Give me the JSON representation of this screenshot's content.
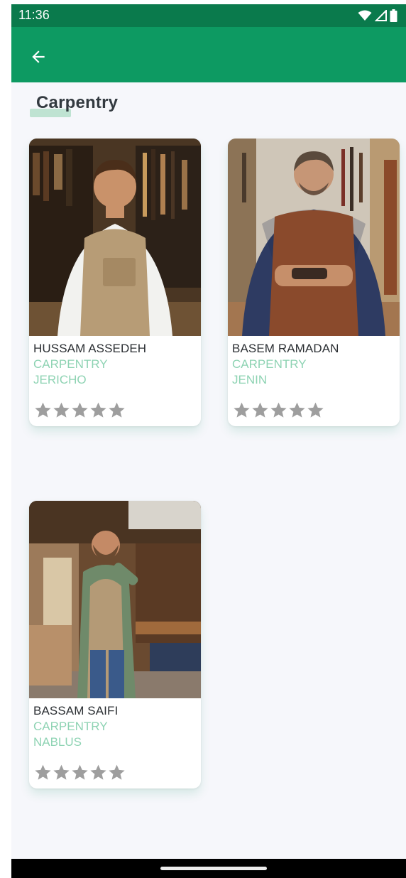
{
  "status_bar": {
    "time": "11:36",
    "icons": [
      "wifi-icon",
      "cell-signal-icon",
      "battery-icon"
    ]
  },
  "app_bar": {
    "back_icon": "arrow-back-icon",
    "background_color": "#0d9a62",
    "status_bar_color": "#0a7a4c"
  },
  "page": {
    "title": "Carpentry"
  },
  "workers": [
    {
      "name": "HUSSAM ASSEDEH",
      "category": "CARPENTRY",
      "city": "JERICHO",
      "rating": 0,
      "max_rating": 5
    },
    {
      "name": "BASEM RAMADAN",
      "category": "CARPENTRY",
      "city": "JENIN",
      "rating": 0,
      "max_rating": 5
    },
    {
      "name": "BASSAM SAIFI",
      "category": "CARPENTRY",
      "city": "NABLUS",
      "rating": 0,
      "max_rating": 5
    }
  ],
  "colors": {
    "accent": "#0d9a62",
    "subtitle": "#8ed3b3",
    "star_empty": "#9e9e9e"
  }
}
